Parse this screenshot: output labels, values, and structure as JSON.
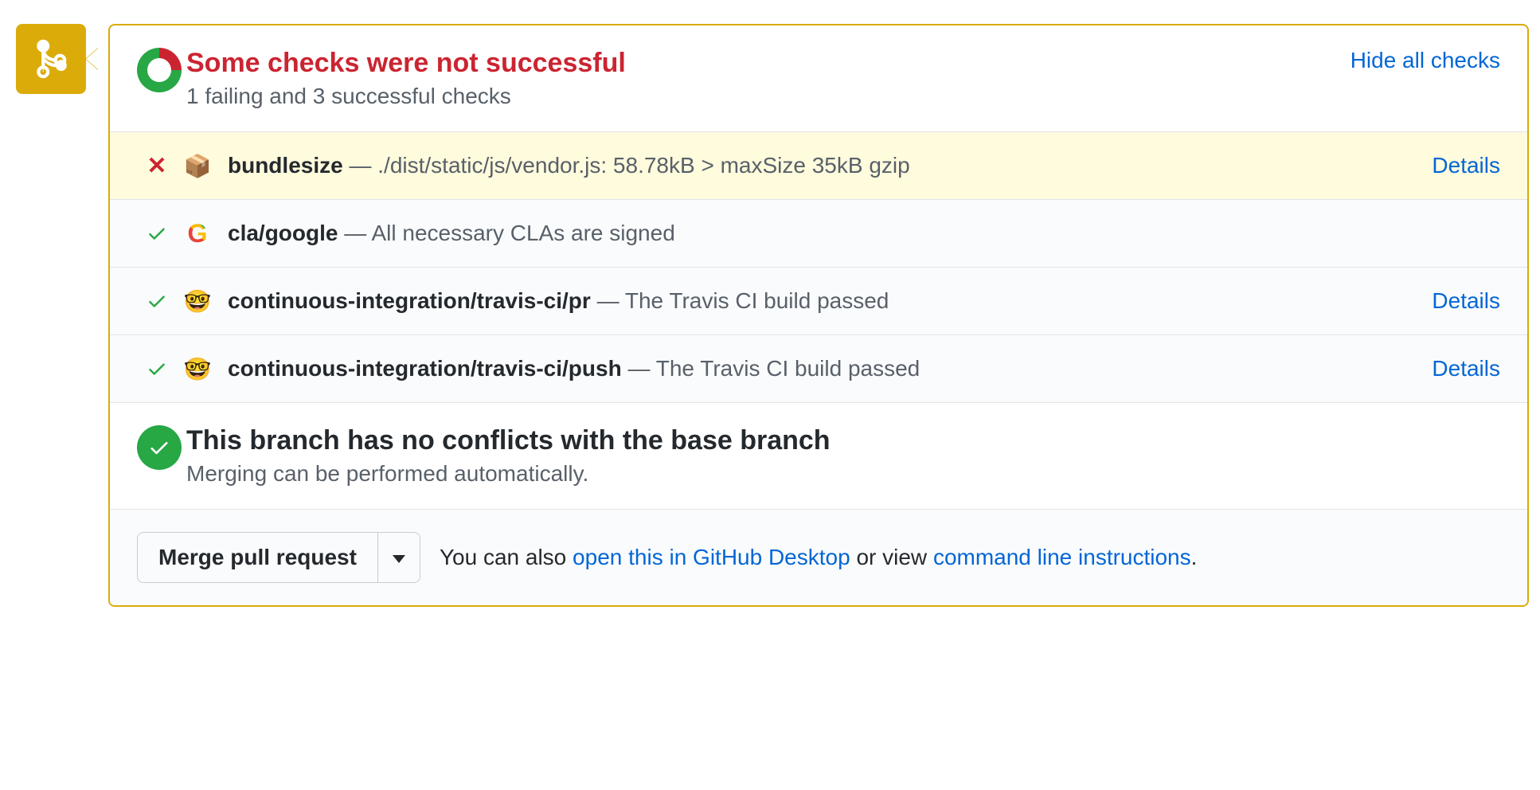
{
  "header": {
    "title": "Some checks were not successful",
    "subtitle": "1 failing and 3 successful checks",
    "hide_link": "Hide all checks"
  },
  "checks": [
    {
      "status": "failed",
      "icon": "📦",
      "name": "bundlesize",
      "sep": " — ",
      "message": "./dist/static/js/vendor.js: 58.78kB > maxSize 35kB gzip",
      "details": "Details"
    },
    {
      "status": "passed",
      "icon": "G",
      "icon_type": "google",
      "name": "cla/google",
      "sep": " — ",
      "message": "All necessary CLAs are signed",
      "details": ""
    },
    {
      "status": "passed",
      "icon": "🤓",
      "name": "continuous-integration/travis-ci/pr",
      "sep": " — ",
      "message": "The Travis CI build passed",
      "details": "Details"
    },
    {
      "status": "passed",
      "icon": "🤓",
      "name": "continuous-integration/travis-ci/push",
      "sep": " — ",
      "message": "The Travis CI build passed",
      "details": "Details"
    }
  ],
  "conflicts": {
    "title": "This branch has no conflicts with the base branch",
    "subtitle": "Merging can be performed automatically."
  },
  "footer": {
    "merge_button": "Merge pull request",
    "text_pre": "You can also ",
    "link_desktop": "open this in GitHub Desktop",
    "text_mid": " or view ",
    "link_cli": "command line instructions",
    "text_post": "."
  }
}
